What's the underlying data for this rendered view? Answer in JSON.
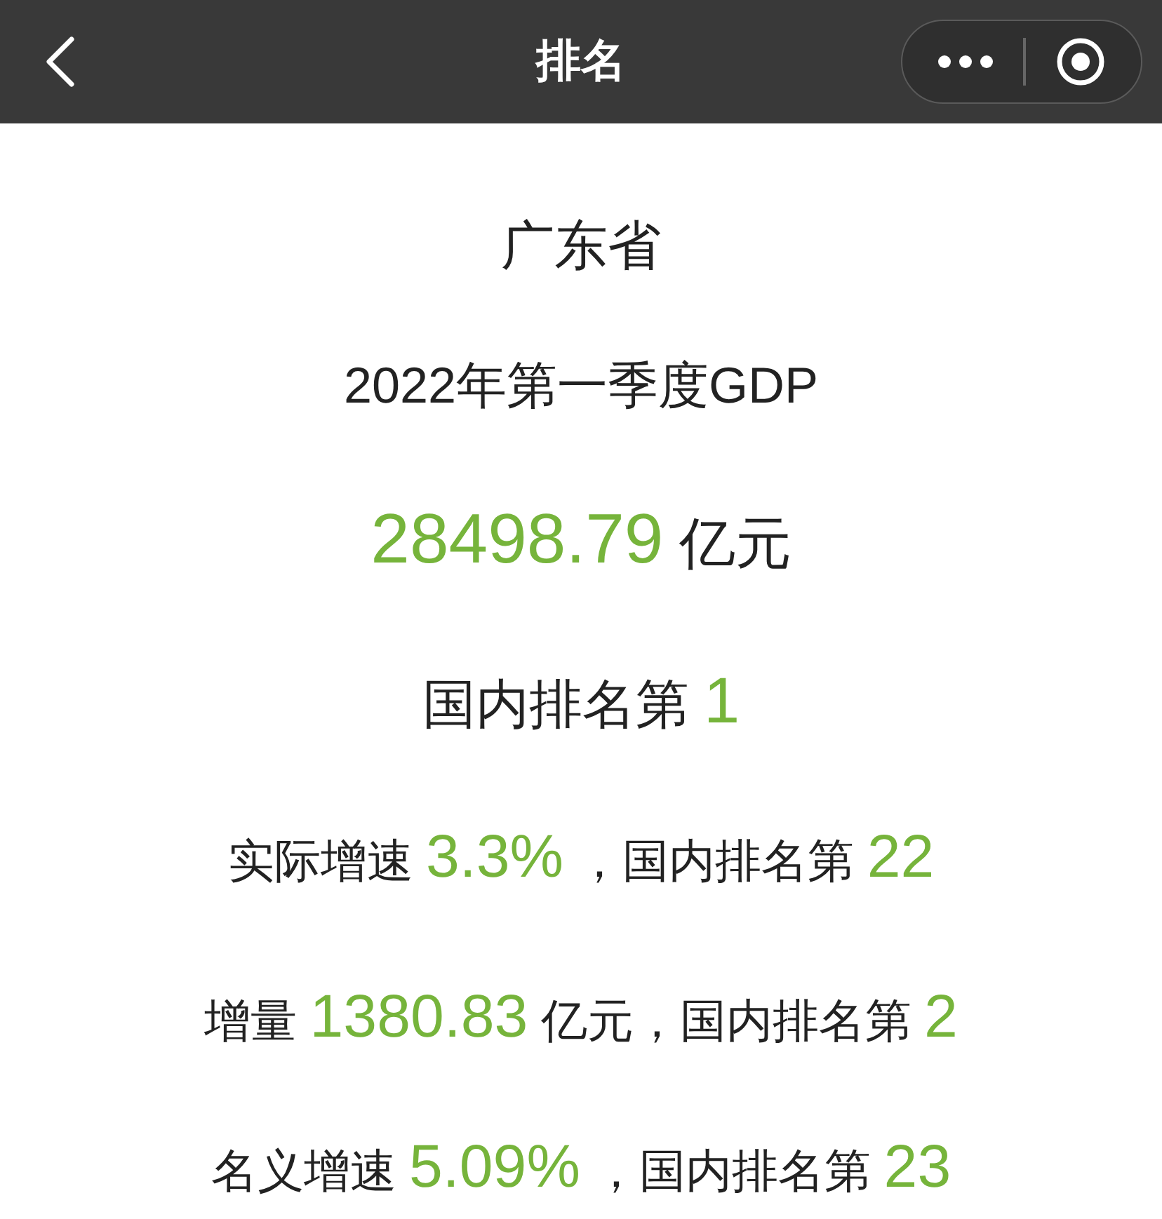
{
  "nav_bar": {
    "title": "排名"
  },
  "lines": [
    [
      {
        "text": "广东省",
        "highlight": false
      }
    ],
    [
      {
        "text": "2022年第一季度GDP",
        "highlight": false
      }
    ],
    [
      {
        "text": "28498.79",
        "highlight": true
      },
      {
        "text": " 亿元",
        "highlight": false
      }
    ],
    [
      {
        "text": "国内排名第 ",
        "highlight": false
      },
      {
        "text": "1",
        "highlight": true
      }
    ],
    [
      {
        "text": "实际增速 ",
        "highlight": false
      },
      {
        "text": "3.3%",
        "highlight": true
      },
      {
        "text": " ，国内排名第 ",
        "highlight": false
      },
      {
        "text": "22",
        "highlight": true
      }
    ],
    [
      {
        "text": "增量 ",
        "highlight": false
      },
      {
        "text": "1380.83",
        "highlight": true
      },
      {
        "text": " 亿元，国内排名第 ",
        "highlight": false
      },
      {
        "text": "2",
        "highlight": true
      }
    ],
    [
      {
        "text": "名义增速 ",
        "highlight": false
      },
      {
        "text": "5.09%",
        "highlight": true
      },
      {
        "text": " ，国内排名第 ",
        "highlight": false
      },
      {
        "text": "23",
        "highlight": true
      }
    ]
  ]
}
